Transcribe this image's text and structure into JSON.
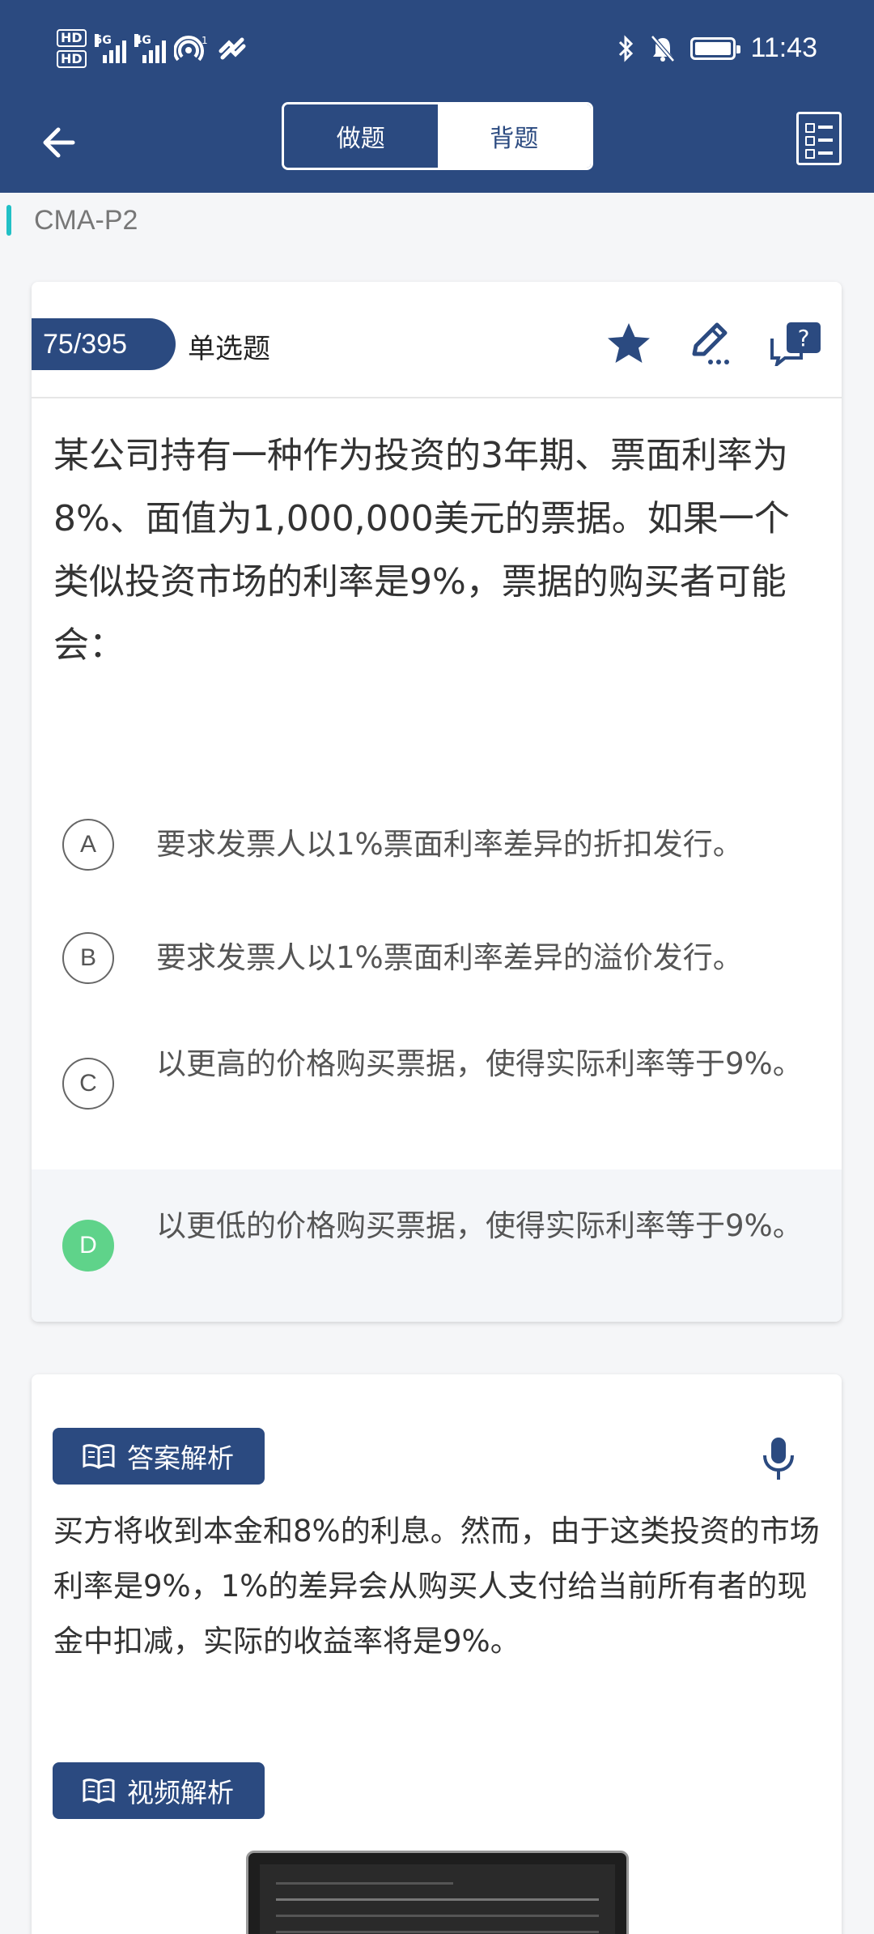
{
  "status_bar": {
    "hd1": "HD",
    "hd2": "HD",
    "net1": "5G",
    "net2": "4G",
    "hotspot_count": "1",
    "time": "11:43"
  },
  "header": {
    "tabs": [
      {
        "label": "做题",
        "active": true
      },
      {
        "label": "背题",
        "active": false
      }
    ]
  },
  "subject": "CMA-P2",
  "question": {
    "counter": "75/395",
    "type": "单选题",
    "text": "某公司持有一种作为投资的3年期、票面利率为8%、面值为1,000,000美元的票据。如果一个类似投资市场的利率是9%，票据的购买者可能会：",
    "options": [
      {
        "letter": "A",
        "text": "要求发票人以1%票面利率差异的折扣发行。"
      },
      {
        "letter": "B",
        "text": "要求发票人以1%票面利率差异的溢价发行。"
      },
      {
        "letter": "C",
        "text": "以更高的价格购买票据，使得实际利率等于9%。"
      },
      {
        "letter": "D",
        "text": "以更低的价格购买票据，使得实际利率等于9%。"
      }
    ],
    "selected": "D"
  },
  "analysis": {
    "answer_tag": "答案解析",
    "answer_text": "买方将收到本金和8%的利息。然而，由于这类投资的市场利率是9%，1%的差异会从购买人支付给当前所有者的现金中扣减，实际的收益率将是9%。",
    "video_tag": "视频解析"
  },
  "colors": {
    "primary": "#2b4a80",
    "accent": "#21c0c6",
    "correct": "#5fd38a"
  }
}
